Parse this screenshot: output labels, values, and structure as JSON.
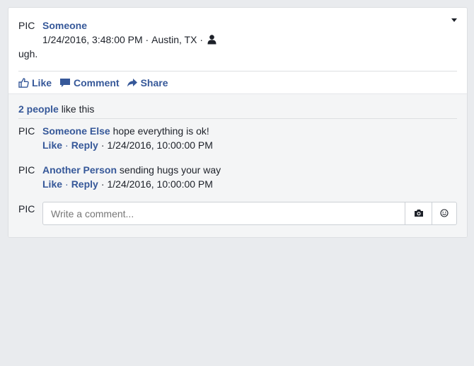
{
  "post": {
    "pic_label": "PIC",
    "author": "Someone",
    "timestamp": "1/24/2016, 3:48:00 PM",
    "separator1": " · ",
    "location": "Austin, TX",
    "separator2": " · ",
    "privacy_icon": "person-icon",
    "body": "ugh."
  },
  "actions": {
    "like": "Like",
    "comment": "Comment",
    "share": "Share"
  },
  "likes": {
    "count_text": "2 people",
    "suffix": "like this"
  },
  "comments": [
    {
      "pic_label": "PIC",
      "author": "Someone Else",
      "text": "hope everything is ok!",
      "like": "Like",
      "dot1": "·",
      "reply": "Reply",
      "dot2": "·",
      "timestamp": "1/24/2016, 10:00:00 PM"
    },
    {
      "pic_label": "PIC",
      "author": "Another Person",
      "text": "sending hugs your way",
      "like": "Like",
      "dot1": "·",
      "reply": "Reply",
      "dot2": "·",
      "timestamp": "1/24/2016, 10:00:00 PM"
    }
  ],
  "composer": {
    "pic_label": "PIC",
    "placeholder": "Write a comment...",
    "camera_icon": "camera-icon",
    "emoji_icon": "smiley-icon"
  },
  "colors": {
    "link": "#365899",
    "background": "#e9ebee",
    "card": "#ffffff",
    "comments_bg": "#f4f5f6"
  }
}
